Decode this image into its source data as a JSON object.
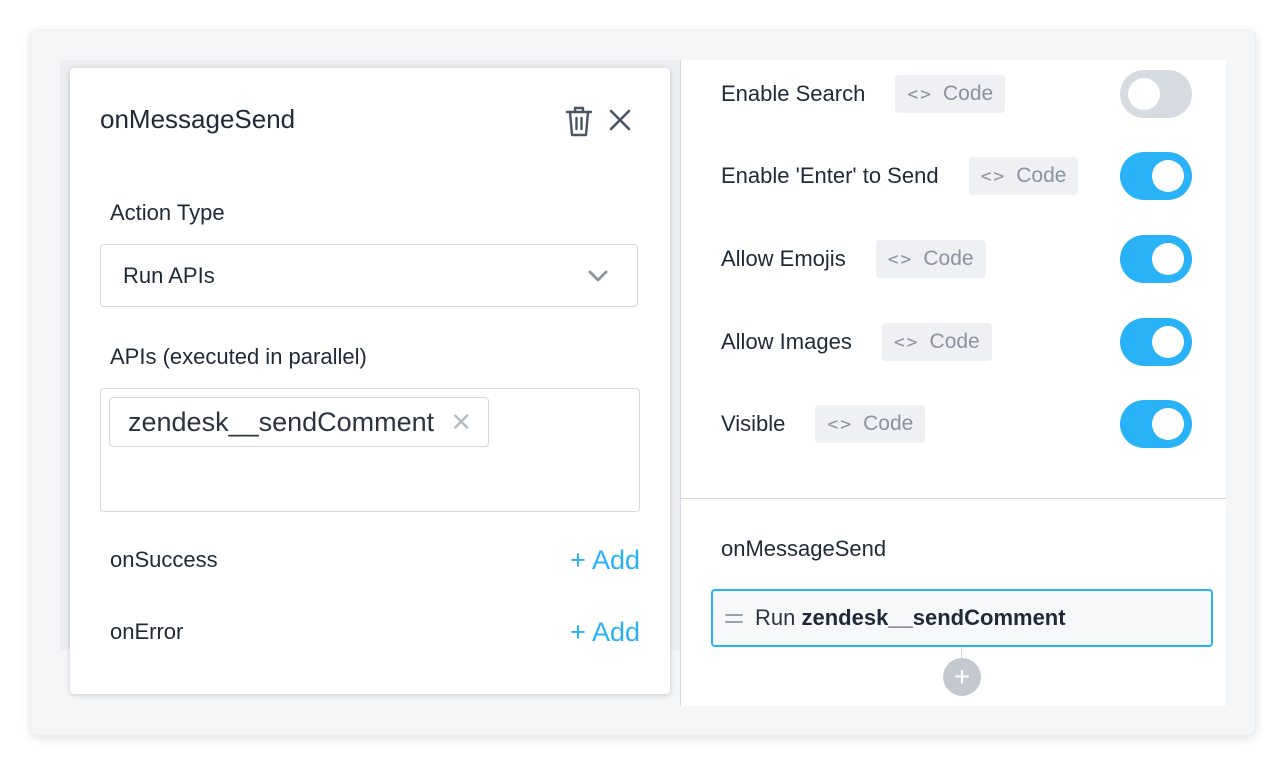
{
  "modal": {
    "title": "onMessageSend",
    "action_type_label": "Action Type",
    "action_type_value": "Run APIs",
    "apis_label": "APIs (executed in parallel)",
    "api_tags": [
      "zendesk__sendComment"
    ],
    "tag_remove": "✕",
    "on_success_label": "onSuccess",
    "on_error_label": "onError",
    "add_label": "+ Add"
  },
  "properties": {
    "code_label": "Code",
    "code_icon": "<>",
    "items": [
      {
        "label": "Enable Search",
        "enabled": false
      },
      {
        "label": "Enable 'Enter' to Send",
        "enabled": true
      },
      {
        "label": "Allow Emojis",
        "enabled": true
      },
      {
        "label": "Allow Images",
        "enabled": true
      },
      {
        "label": "Visible",
        "enabled": true
      }
    ]
  },
  "events": {
    "title": "onMessageSend",
    "item_prefix": "Run",
    "item_name": "zendesk__sendComment",
    "add_icon": "+"
  },
  "colors": {
    "accent": "#29b2f8",
    "toggle_off": "#d6dbe1"
  }
}
